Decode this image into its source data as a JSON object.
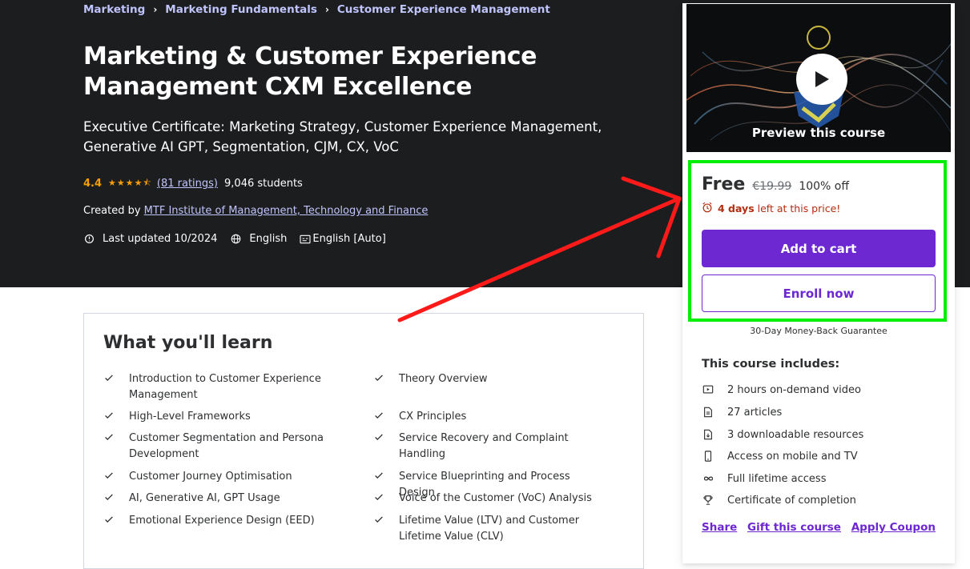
{
  "breadcrumb": {
    "items": [
      "Marketing",
      "Marketing Fundamentals",
      "Customer Experience Management"
    ]
  },
  "course": {
    "title": "Marketing & Customer Experience Management CXM Excellence",
    "subtitle": "Executive Certificate: Marketing Strategy, Customer Experience Management, Generative AI GPT, Segmentation, CJM, CX, VoC",
    "rating": "4.4",
    "stars": 4.4,
    "ratings_count": "(81 ratings)",
    "students": "9,046 students",
    "created_by_label": "Created by",
    "instructor": "MTF Institute of Management, Technology and Finance",
    "last_updated": "Last updated 10/2024",
    "language": "English",
    "captions": "English [Auto]"
  },
  "learn": {
    "heading": "What you'll learn",
    "left": [
      "Introduction to Customer Experience Management",
      "High-Level Frameworks",
      "Customer Segmentation and Persona Development",
      "Customer Journey Optimisation",
      "AI, Generative AI, GPT Usage",
      "Emotional Experience Design (EED)"
    ],
    "right": [
      "Theory Overview",
      "CX Principles",
      "Service Recovery and Complaint Handling",
      "Service Blueprinting and Process Design",
      "Voice of the Customer (VoC) Analysis",
      "Lifetime Value (LTV) and Customer Lifetime Value (CLV)"
    ]
  },
  "sidebar": {
    "preview_label": "Preview this course",
    "price": "Free",
    "original_price": "€19.99",
    "discount": "100% off",
    "timer_days": "4 days",
    "timer_rest": "left at this price!",
    "add_to_cart": "Add to cart",
    "enroll_now": "Enroll now",
    "guarantee": "30-Day Money-Back Guarantee",
    "includes_heading": "This course includes:",
    "includes": [
      {
        "icon": "video-icon",
        "label": "2 hours on-demand video"
      },
      {
        "icon": "article-icon",
        "label": "27 articles"
      },
      {
        "icon": "download-icon",
        "label": "3 downloadable resources"
      },
      {
        "icon": "mobile-icon",
        "label": "Access on mobile and TV"
      },
      {
        "icon": "infinity-icon",
        "label": "Full lifetime access"
      },
      {
        "icon": "trophy-icon",
        "label": "Certificate of completion"
      }
    ],
    "links": [
      "Share",
      "Gift this course",
      "Apply Coupon"
    ]
  },
  "colors": {
    "hero_bg": "#1c1d1f",
    "link": "#c0c4fc",
    "star": "#f69c08",
    "brand": "#6d28d2",
    "timer": "#b32d0f",
    "annotation_box": "#00ee00",
    "annotation_arrow": "#ff1a1a"
  }
}
